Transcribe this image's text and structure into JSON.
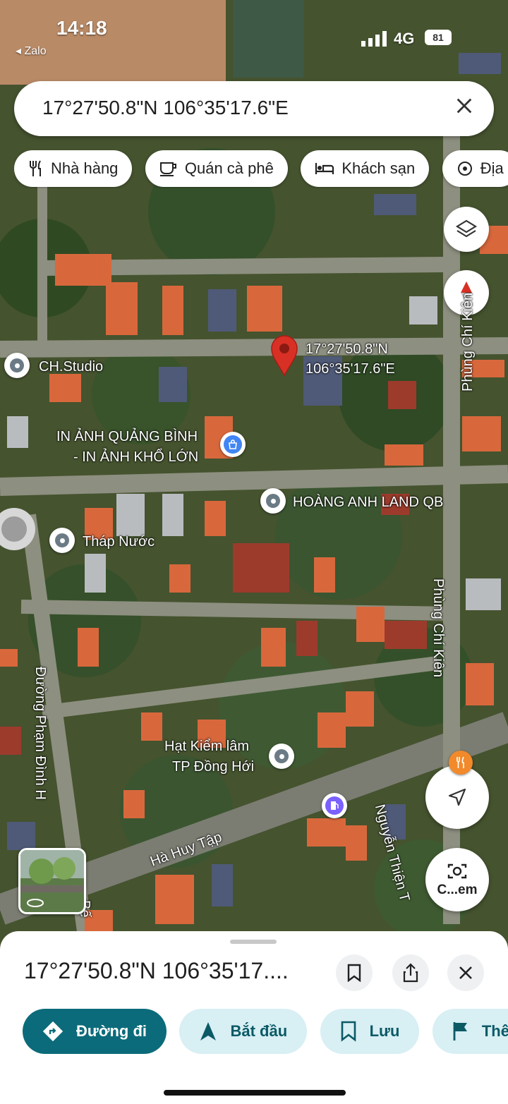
{
  "status_bar": {
    "time": "14:18",
    "back_app": "◂ Zalo",
    "network": "4G",
    "battery": "81"
  },
  "search": {
    "query": "17°27'50.8\"N 106°35'17.6\"E"
  },
  "chips": [
    {
      "label": "Nhà hàng",
      "icon": "restaurant-icon"
    },
    {
      "label": "Quán cà phê",
      "icon": "coffee-icon"
    },
    {
      "label": "Khách sạn",
      "icon": "hotel-icon"
    },
    {
      "label": "Địa",
      "icon": "attraction-icon"
    }
  ],
  "map": {
    "pin_label_line1": "17°27'50.8\"N",
    "pin_label_line2": "106°35'17.6\"E",
    "places": {
      "ch_studio": "CH.Studio",
      "in_anh_line1": "IN ẢNH QUẢNG BÌNH",
      "in_anh_line2": "- IN ẢNH KHỔ LỚN",
      "hoang_anh": "HOÀNG ANH LAND QB",
      "thap_nuoc": "Tháp Nước",
      "hat_kiem_lam_line1": "Hạt Kiểm lâm",
      "hat_kiem_lam_line2": "TP Đồng Hới"
    },
    "streets": {
      "phung_chi_kien_top": "Phùng Chí Kiên",
      "phung_chi_kien_mid": "Phùng Chí Kiên",
      "pham_dinh_ho": "Đường Phạm Đình H",
      "ha_huy_tap": "Hà Huy Tập",
      "nguyen_thien": "Nguyễn Thiện T",
      "ben": "Bế"
    },
    "lens_label": "C...em"
  },
  "sheet": {
    "title": "17°27'50.8\"N 106°35'17....",
    "actions": [
      {
        "label": "Đường đi",
        "icon": "directions-icon",
        "style": "primary"
      },
      {
        "label": "Bắt đầu",
        "icon": "navigate-icon",
        "style": "secondary"
      },
      {
        "label": "Lưu",
        "icon": "bookmark-icon",
        "style": "secondary"
      },
      {
        "label": "Thêm",
        "icon": "flag-icon",
        "style": "secondary"
      }
    ]
  },
  "colors": {
    "primary": "#0b6b7a",
    "secondary_bg": "#d8eff4",
    "pin": "#d93025"
  }
}
